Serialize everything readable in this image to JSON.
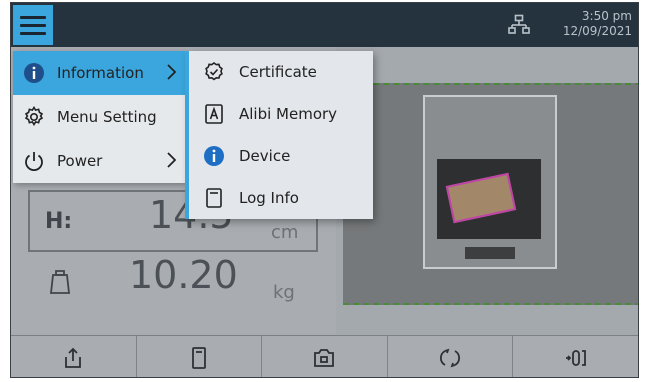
{
  "status": {
    "time": "3:50 pm",
    "date": "12/09/2021",
    "network_icon": "network-icon"
  },
  "colors": {
    "accent": "#3aa6dd",
    "topbar": "#25333e",
    "menu_bg": "#e6e9ec",
    "box_outline": "#c043a8"
  },
  "menu": {
    "items": [
      {
        "label": "Information",
        "icon": "info-icon",
        "has_submenu": true,
        "active": true
      },
      {
        "label": "Menu Setting",
        "icon": "gear-icon",
        "has_submenu": false,
        "active": false
      },
      {
        "label": "Power",
        "icon": "power-icon",
        "has_submenu": true,
        "active": false
      }
    ]
  },
  "submenu": {
    "items": [
      {
        "label": "Certificate",
        "icon": "certificate-check-icon"
      },
      {
        "label": "Alibi Memory",
        "icon": "alibi-memory-icon"
      },
      {
        "label": "Device",
        "icon": "info-icon"
      },
      {
        "label": "Log Info",
        "icon": "log-icon"
      }
    ]
  },
  "measurement": {
    "height": {
      "label": "H:",
      "value": "14.5",
      "unit": "cm"
    },
    "weight": {
      "value": "10.20",
      "unit": "kg",
      "icon": "weight-icon"
    }
  },
  "bottom_bar": {
    "buttons": [
      {
        "icon": "export-icon"
      },
      {
        "icon": "memory-icon"
      },
      {
        "icon": "camera-icon"
      },
      {
        "icon": "refresh-icon"
      },
      {
        "icon": "zero-icon"
      }
    ]
  }
}
